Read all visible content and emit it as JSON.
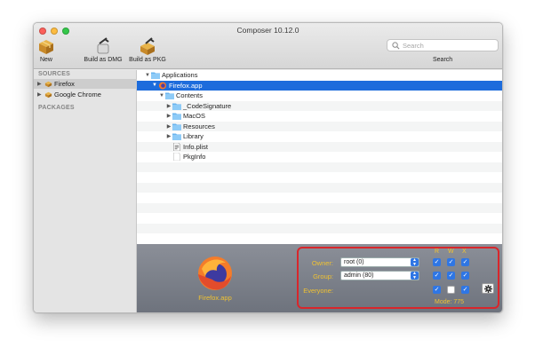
{
  "window": {
    "title": "Composer 10.12.0"
  },
  "toolbar": {
    "new_label": "New",
    "build_dmg_label": "Build as DMG",
    "build_pkg_label": "Build as PKG",
    "search_placeholder": "Search",
    "search_caption": "Search"
  },
  "sidebar": {
    "sources_header": "SOURCES",
    "packages_header": "PACKAGES",
    "items": [
      {
        "label": "Firefox",
        "selected": true
      },
      {
        "label": "Google Chrome",
        "selected": false
      }
    ]
  },
  "tree": {
    "rows": [
      {
        "label": "Applications",
        "icon": "folder-icon",
        "expanded": true
      },
      {
        "label": "Firefox.app",
        "icon": "firefox-icon",
        "expanded": true,
        "selected": true
      },
      {
        "label": "Contents",
        "icon": "folder-icon",
        "expanded": true
      },
      {
        "label": "_CodeSignature",
        "icon": "folder-icon",
        "expanded": false
      },
      {
        "label": "MacOS",
        "icon": "folder-icon",
        "expanded": false
      },
      {
        "label": "Resources",
        "icon": "folder-icon",
        "expanded": false
      },
      {
        "label": "Library",
        "icon": "folder-icon",
        "expanded": false
      },
      {
        "label": "Info.plist",
        "icon": "plist-file-icon"
      },
      {
        "label": "PkgInfo",
        "icon": "document-icon"
      }
    ]
  },
  "info": {
    "app_name": "Firefox.app",
    "owner_label": "Owner:",
    "owner_value": "root (0)",
    "group_label": "Group:",
    "group_value": "admin (80)",
    "everyone_label": "Everyone:",
    "r_header": "R",
    "w_header": "W",
    "x_header": "X",
    "mode_text": "Mode: 775",
    "permissions": {
      "owner": [
        true,
        true,
        true
      ],
      "group": [
        true,
        true,
        true
      ],
      "everyone": [
        true,
        false,
        true
      ]
    },
    "accent_color": "#f0c232",
    "highlight_color": "#d8262b"
  }
}
